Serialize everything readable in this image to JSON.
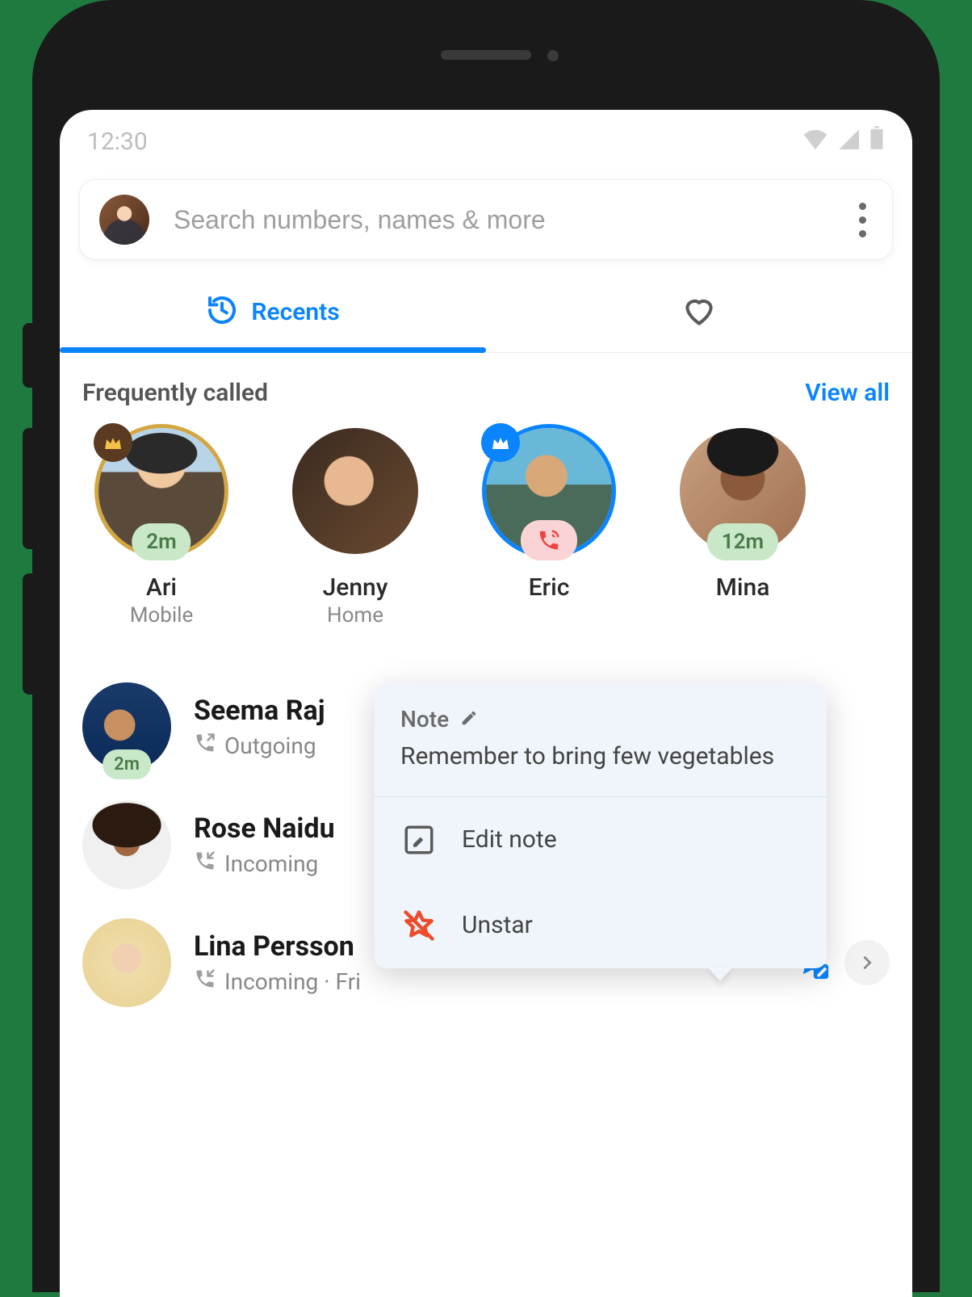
{
  "status_bar": {
    "time": "12:30"
  },
  "search": {
    "placeholder": "Search numbers, names & more"
  },
  "tabs": {
    "recents_label": "Recents",
    "recents_active": true
  },
  "frequent": {
    "title": "Frequently called",
    "view_all": "View all",
    "items": [
      {
        "name": "Ari",
        "sub": "Mobile",
        "time_badge": "2m",
        "crown": "brown",
        "ring": "gold"
      },
      {
        "name": "Jenny",
        "sub": "Home"
      },
      {
        "name": "Eric",
        "sub": "",
        "crown": "blue",
        "ring": "blue",
        "call_badge": true
      },
      {
        "name": "Mina",
        "sub": "",
        "time_badge": "12m"
      }
    ]
  },
  "calls": [
    {
      "name": "Seema Raj",
      "direction": "Outgoing",
      "time_badge": "2m"
    },
    {
      "name": "Rose Naidu",
      "direction": "Incoming"
    },
    {
      "name": "Lina Persson",
      "direction": "Incoming · Fri",
      "show_actions": true
    }
  ],
  "popup": {
    "note_label": "Note",
    "note_text": "Remember to bring few vegetables",
    "edit_label": "Edit note",
    "unstar_label": "Unstar"
  }
}
